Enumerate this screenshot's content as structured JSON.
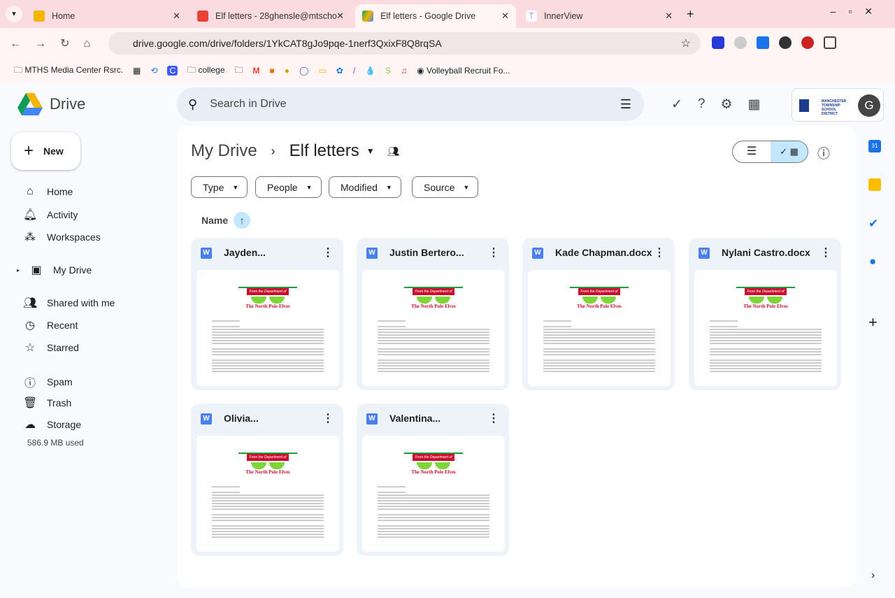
{
  "browser": {
    "tabs": [
      {
        "label": "Home"
      },
      {
        "label": "Elf letters - 28ghensle@mtscho"
      },
      {
        "label": "Elf letters - Google Drive"
      },
      {
        "label": "InnerView"
      }
    ],
    "url": "drive.google.com/drive/folders/1YkCAT8gJo9pqe-1nerf3QxixF8Q8rqSA",
    "bookmarks": [
      "MTHS Media Center Rsrc.",
      "college",
      "Volleyball Recruit Fo..."
    ]
  },
  "drive": {
    "logo": "Drive",
    "search_placeholder": "Search in Drive",
    "new_label": "New",
    "org_logo": "MANCHESTER TOWNSHIP SCHOOL DISTRICT",
    "avatar": "G",
    "nav": [
      "Home",
      "Activity",
      "Workspaces",
      "My Drive",
      "Shared with me",
      "Recent",
      "Starred",
      "Spam",
      "Trash",
      "Storage"
    ],
    "storage_used": "586.9 MB used",
    "breadcrumb": {
      "root": "My Drive",
      "current": "Elf letters"
    },
    "filters": [
      "Type",
      "People",
      "Modified",
      "Source"
    ],
    "sort_label": "Name",
    "files": [
      {
        "name": "Jayden..."
      },
      {
        "name": "Justin Bertero..."
      },
      {
        "name": "Kade Chapman.docx"
      },
      {
        "name": "Nylani Castro.docx"
      },
      {
        "name": "Olivia..."
      },
      {
        "name": "Valentina..."
      }
    ],
    "preview": {
      "banner": "From the Department of",
      "title": "The North Pole Elves"
    }
  }
}
